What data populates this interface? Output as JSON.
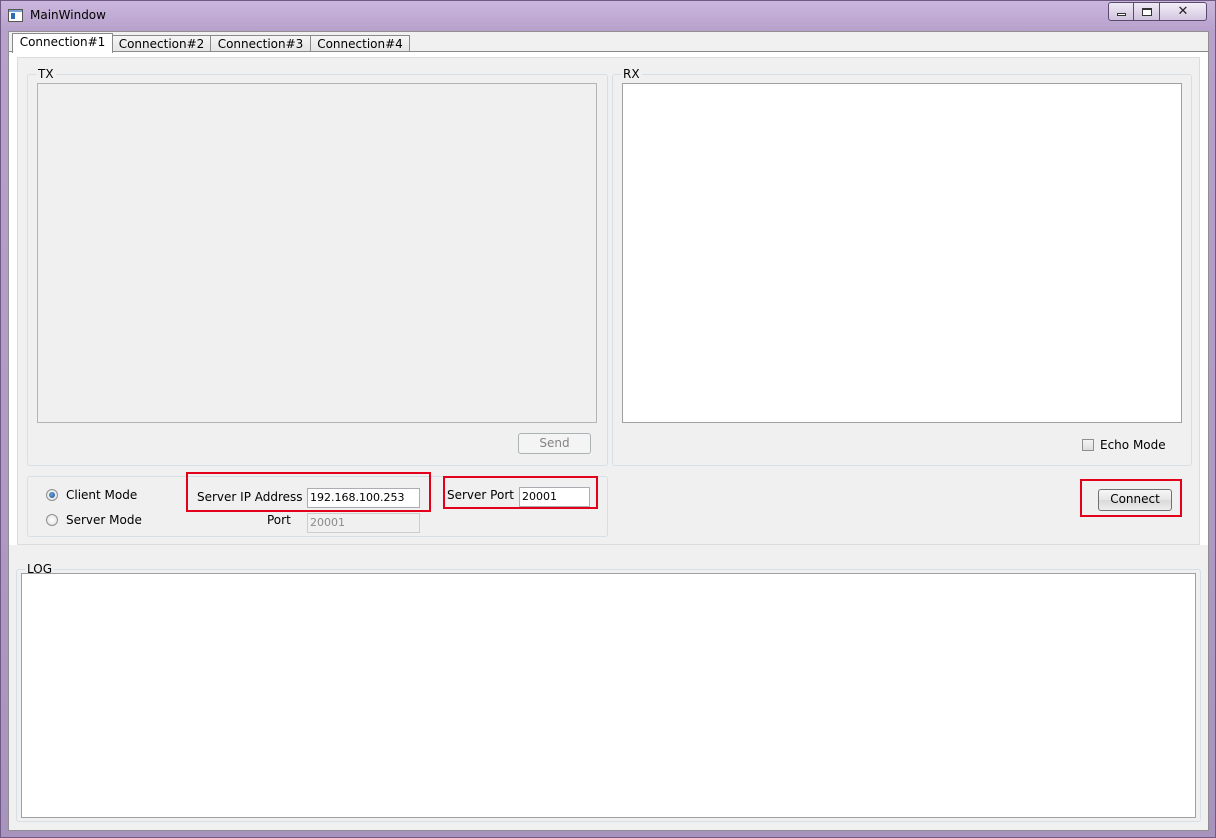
{
  "window": {
    "title": "MainWindow"
  },
  "tabs": [
    {
      "label": "Connection#1",
      "active": true
    },
    {
      "label": "Connection#2",
      "active": false
    },
    {
      "label": "Connection#3",
      "active": false
    },
    {
      "label": "Connection#4",
      "active": false
    }
  ],
  "tx": {
    "title": "TX",
    "text": "",
    "send_label": "Send"
  },
  "rx": {
    "title": "RX",
    "text": "",
    "echo_label": "Echo Mode",
    "echo_checked": false
  },
  "mode": {
    "client_label": "Client Mode",
    "server_label": "Server Mode",
    "selected": "Client Mode",
    "server_ip_label": "Server IP Address",
    "server_ip_value": "192.168.100.253",
    "server_port_label": "Server Port",
    "server_port_value": "20001",
    "port_label": "Port",
    "port_value": "20001"
  },
  "connect_label": "Connect",
  "log": {
    "title": "LOG",
    "text": ""
  },
  "colors": {
    "highlight": "#e3001b",
    "frame": "#b9a6c9"
  }
}
